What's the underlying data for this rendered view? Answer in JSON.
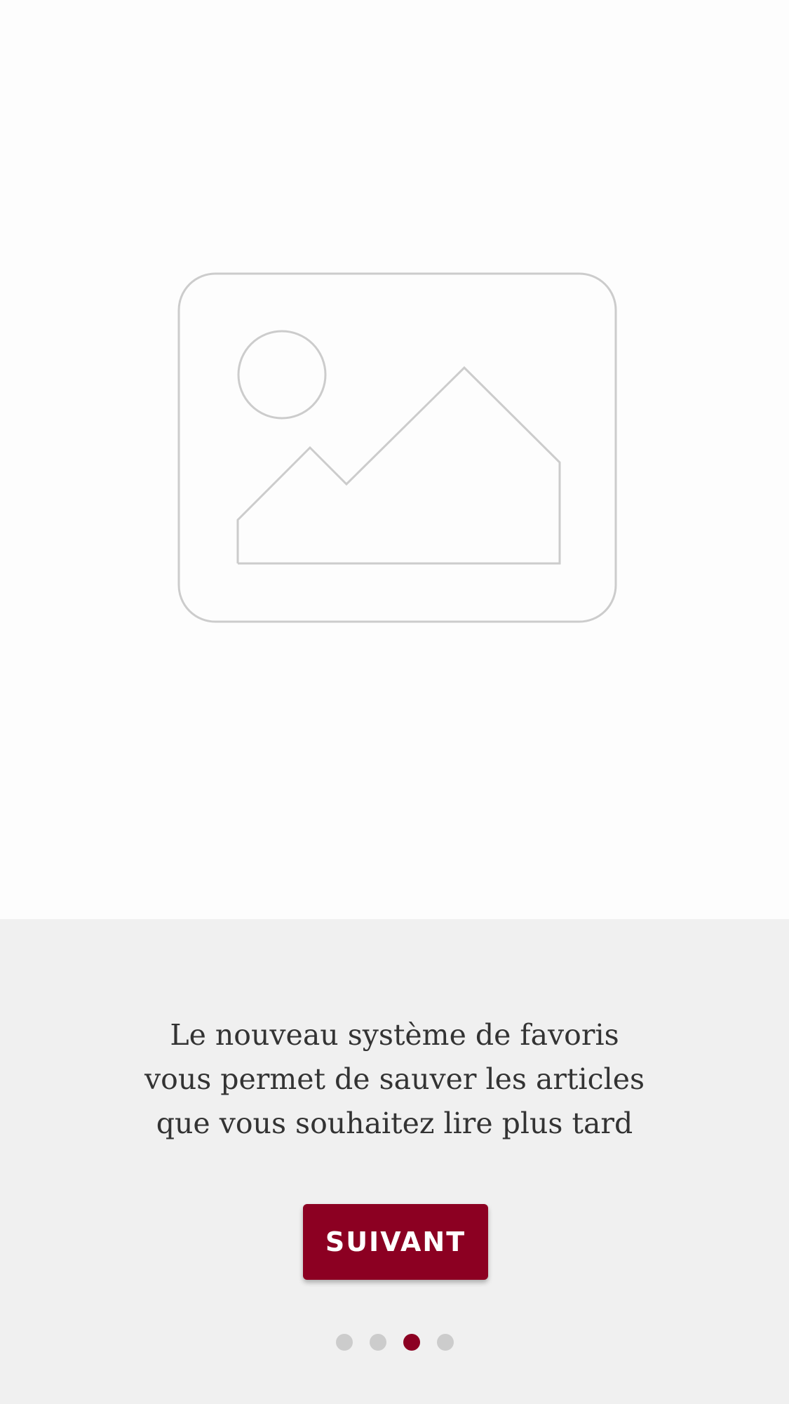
{
  "hero": {
    "icon": "image-placeholder-icon"
  },
  "onboarding": {
    "message_lines": [
      "Le nouveau système de favoris",
      "vous permet de sauver les articles",
      "que vous souhaitez lire plus tard"
    ],
    "next_label": "SUIVANT"
  },
  "pagination": {
    "total": 4,
    "current": 3
  },
  "colors": {
    "accent": "#8c0022",
    "panel_background": "#f0f0f0",
    "hero_background": "#fdfdfd",
    "inactive_dot": "#cccccc",
    "placeholder_stroke": "#cccccc",
    "text": "#333333"
  }
}
